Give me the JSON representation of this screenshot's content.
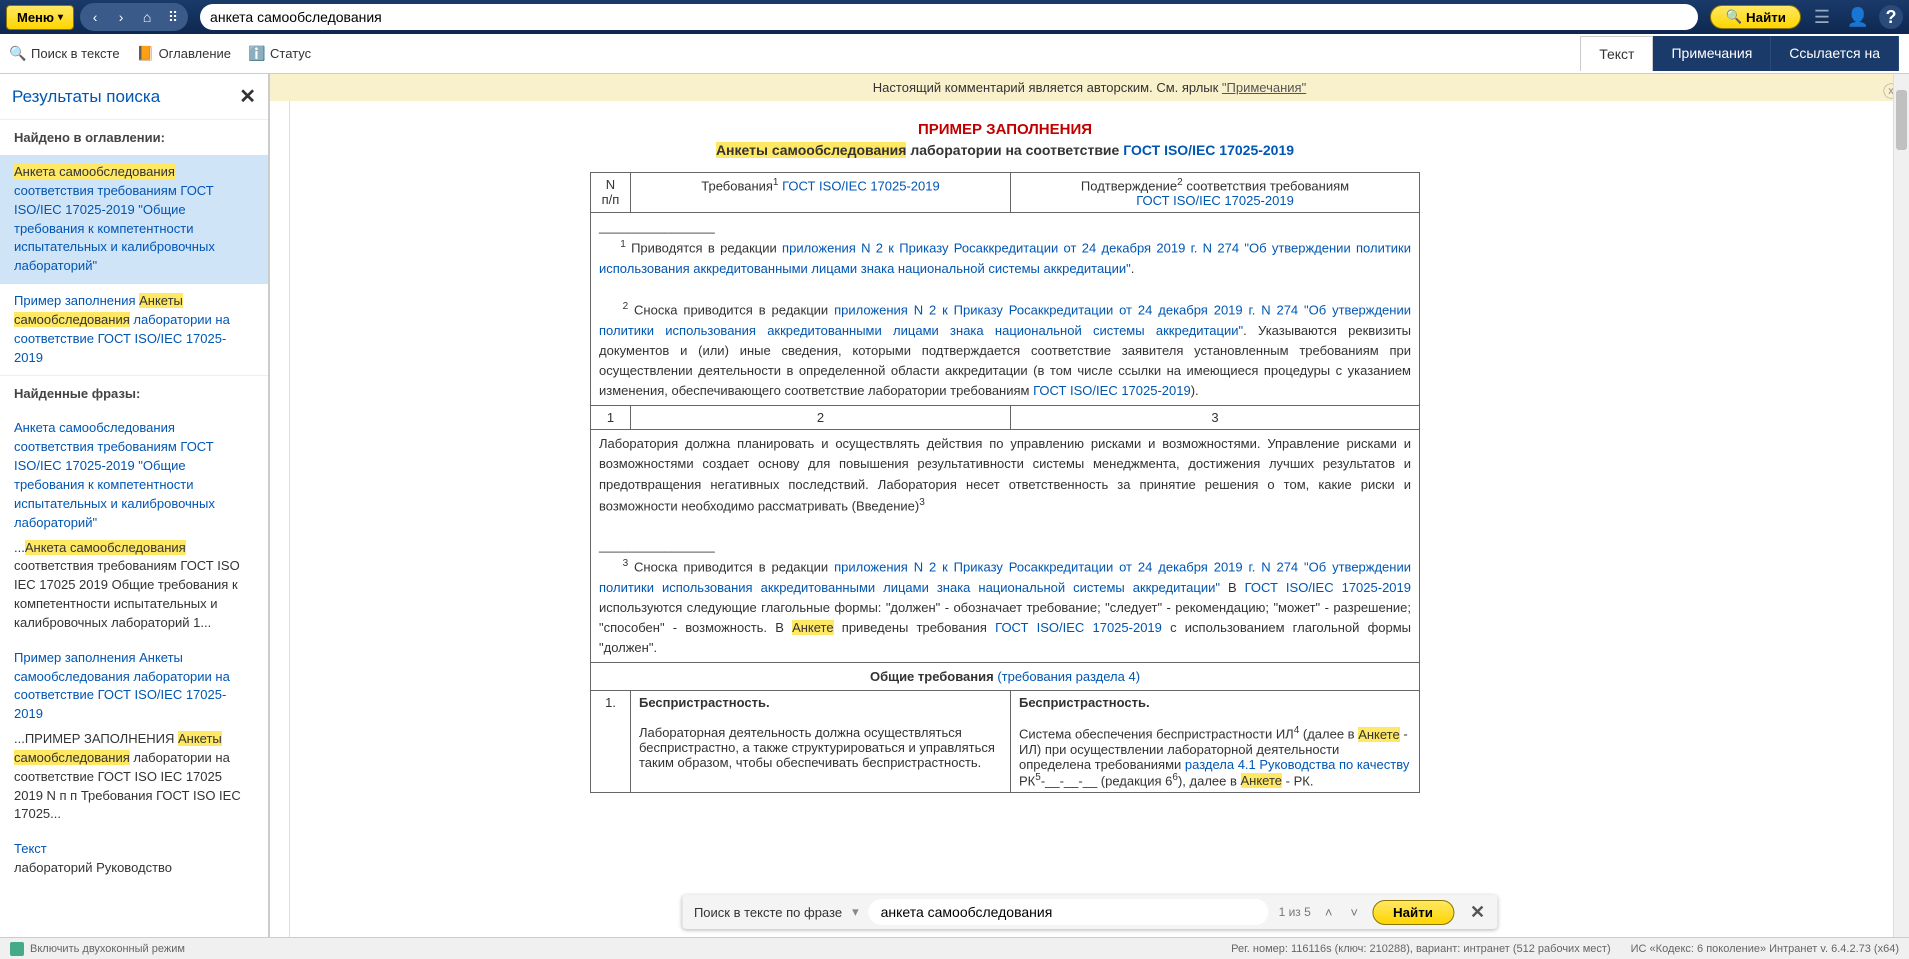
{
  "toolbar": {
    "menu_label": "Меню",
    "search_value": "анкета самообследования",
    "find_label": "Найти"
  },
  "sub": {
    "search_text": "Поиск в тексте",
    "toc": "Оглавление",
    "status": "Статус"
  },
  "tabs": {
    "text": "Текст",
    "notes": "Примечания",
    "refs": "Ссылается на"
  },
  "sidebar": {
    "title": "Результаты поиска",
    "found_toc": "Найдено в оглавлении:",
    "found_phrases": "Найденные фразы:",
    "toc1_hl": "Анкета самообследования",
    "toc1_rest": " соответствия требованиям ГОСТ ISO/IEC 17025-2019 \"Общие требования к компетентности испытательных и калибровочных лабораторий\"",
    "toc2_pre": "Пример заполнения ",
    "toc2_hl": "Анкеты самообследования",
    "toc2_post": " лаборатории на соответствие ГОСТ ISO/IEC 17025-2019",
    "ph1_link": "Анкета самообследования соответствия требованиям ГОСТ ISO/IEC 17025-2019 \"Общие требования к компетентности испытательных и калибровочных лабораторий\"",
    "ph1_pre": "...",
    "ph1_hl": "Анкета самообследования",
    "ph1_post": " соответствия требованиям ГОСТ ISO IEC 17025 2019 Общие требования к компетентности испытательных и калибровочных лабораторий 1...",
    "ph2_link": "Пример заполнения Анкеты самообследования лаборатории на соответствие ГОСТ ISO/IEC 17025-2019",
    "ph2_pre": "...ПРИМЕР ЗАПОЛНЕНИЯ ",
    "ph2_hl": "Анкеты самообследования",
    "ph2_post": " лаборатории на соответствие ГОСТ ISO IEC 17025 2019 N п п Требования ГОСТ ISO IEC 17025...",
    "ph3_link": "Текст",
    "ph3_post": "лабораторий Руководство"
  },
  "notice": {
    "pre": "Настоящий комментарий является авторским. См. ярлык ",
    "link": "\"Примечания\""
  },
  "doc": {
    "title1": "ПРИМЕР ЗАПОЛНЕНИЯ",
    "title2_hl": "Анкеты самообследования",
    "title2_mid": " лаборатории на соответствие ",
    "title2_link": "ГОСТ ISO/IEC 17025-2019",
    "h_col1a": "N",
    "h_col1b": "п/п",
    "h_col2_pre": "Требования",
    "h_col2_link": "ГОСТ ISO/IEC 17025-2019",
    "h_col3_pre": "Подтверждение",
    "h_col3_post": " соответствия требованиям",
    "h_col3_link": "ГОСТ ISO/IEC 17025-2019",
    "fn1_pre": "Приводятся в редакции ",
    "fn1_link": "приложения N 2 к Приказу Росаккредитации от 24 декабря 2019 г. N 274 \"Об утверждении политики использования аккредитованными лицами знака национальной системы аккредитации\"",
    "fn2_pre": "Сноска приводится в редакции ",
    "fn2_link": "приложения N 2 к Приказу Росаккредитации от 24 декабря 2019 г. N 274 \"Об утверждении политики использования аккредитованными лицами знака национальной системы аккредитации\"",
    "fn2_post1": ". Указываются реквизиты документов и (или) иные сведения, которыми подтверждается соответствие заявителя установленным требованиям при осуществлении деятельности в определенной области аккредитации (в том числе ссылки на имеющиеся процедуры с указанием изменения, обеспечивающего соответствие лаборатории требованиям ",
    "fn2_link2": "ГОСТ ISO/IEC 17025-2019",
    "fn2_post2": ").",
    "row_nums": {
      "c1": "1",
      "c2": "2",
      "c3": "3"
    },
    "para1": "Лаборатория должна планировать и осуществлять действия по управлению рисками и возможностями. Управление рисками и возможностями создает основу для повышения результативности системы менеджмента, достижения лучших результатов и предотвращения негативных последствий. Лаборатория несет ответственность за принятие решения о том, какие риски и возможности необходимо рассматривать (Введение)",
    "fn3_pre": "Сноска приводится в редакции ",
    "fn3_link": "приложения N 2 к Приказу Росаккредитации от 24 декабря 2019 г. N 274 \"Об утверждении политики использования аккредитованными лицами знака национальной системы аккредитации\"",
    "fn3_post1": " В ",
    "fn3_link2": "ГОСТ ISO/IEC 17025-2019",
    "fn3_post2": " используются следующие глагольные формы: \"должен\" - обозначает требование; \"следует\" - рекомендацию; \"может\" - разрешение; \"способен\" - возможность. В ",
    "fn3_hl": "Анкете",
    "fn3_post3": " приведены требования ",
    "fn3_link3": "ГОСТ ISO/IEC 17025-2019",
    "fn3_post4": " с использованием глагольной формы \"должен\".",
    "sec_general_pre": "Общие требования ",
    "sec_general_link": "(требования раздела 4)",
    "row1_num": "1.",
    "row1_h2": "Беспристрастность.",
    "row1_h3": "Беспристрастность.",
    "row1_body2": "Лабораторная деятельность должна осуществляться беспристрастно, а также структурироваться и управляться таким образом, чтобы обеспечивать беспристрастность.",
    "row1_b3_pre": "Система обеспечения беспристрастности ИЛ",
    "row1_b3_mid1": " (далее в ",
    "row1_b3_hl1": "Анкете",
    "row1_b3_mid2": " - ИЛ) при осуществлении лабораторной деятельности определена требованиями ",
    "row1_b3_link": "раздела 4.1 Руководства по качеству",
    "row1_b3_mid3": " РК",
    "row1_b3_mid4": "-__-__-__ (редакция 6",
    "row1_b3_mid5": "), далее в ",
    "row1_b3_hl2": "Анкете",
    "row1_b3_mid6": " - РК."
  },
  "findbar": {
    "label": "Поиск в тексте по фразе",
    "value": "анкета самообследования",
    "count": "1 из 5",
    "find": "Найти"
  },
  "status": {
    "dual": "Включить двухоконный режим",
    "reg": "Рег. номер: 116116s (ключ: 210288), вариант: интранет (512 рабочих мест)",
    "sys": "ИС «Кодекс: 6 поколение» Интранет v. 6.4.2.73 (x64)"
  }
}
